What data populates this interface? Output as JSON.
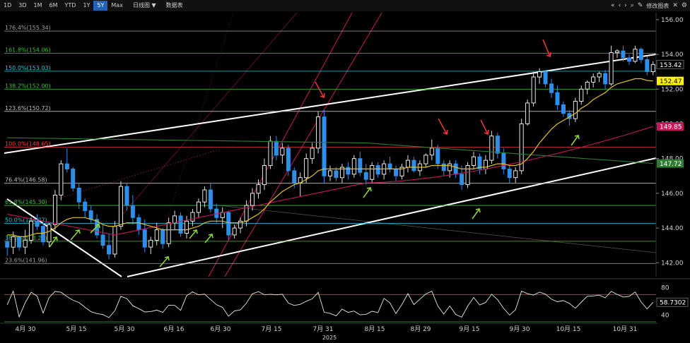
{
  "toolbar": {
    "ranges": [
      {
        "label": "1D",
        "active": false
      },
      {
        "label": "3D",
        "active": false
      },
      {
        "label": "1M",
        "active": false
      },
      {
        "label": "6M",
        "active": false
      },
      {
        "label": "YTD",
        "active": false
      },
      {
        "label": "1Y",
        "active": false
      },
      {
        "label": "5Y",
        "active": true
      },
      {
        "label": "Max",
        "active": false
      }
    ],
    "interval_label": "日线图 ▼",
    "table_label": "数据表",
    "edit_label": "修改图表",
    "icons": [
      "chevrons-left-icon",
      "chevron-left-icon",
      "chevron-right-icon",
      "search-icon",
      "edit-chart-icon",
      "close-icon",
      "gear-icon"
    ]
  },
  "price_axis": {
    "ticks": [
      "156.00",
      "154.00",
      "152.00",
      "150.00",
      "148.00",
      "146.00",
      "144.00",
      "142.00"
    ]
  },
  "price_badges": [
    {
      "label": "153.42",
      "value": 153.42,
      "bg": "#000000",
      "fg": "#ffffff"
    },
    {
      "label": "152.47",
      "value": 152.47,
      "bg": "#fff200",
      "fg": "#000000"
    },
    {
      "label": "149.85",
      "value": 149.85,
      "bg": "#c2185b",
      "fg": "#ffffff"
    },
    {
      "label": "147.72",
      "value": 147.72,
      "bg": "#2e7d32",
      "fg": "#ffffff"
    }
  ],
  "fib_levels": [
    {
      "label": "176.4%(155.34)",
      "value": 155.34,
      "color": "#9e9e9e"
    },
    {
      "label": "161.8%(154.06)",
      "value": 154.06,
      "color": "#39c03a"
    },
    {
      "label": "150.0%(153.03)",
      "value": 153.03,
      "color": "#26c6da"
    },
    {
      "label": "138.2%(152.00)",
      "value": 152.0,
      "color": "#39c03a"
    },
    {
      "label": "123.6%(150.72)",
      "value": 150.72,
      "color": "#bdbdbd"
    },
    {
      "label": "100.0%(148.65)",
      "value": 148.65,
      "color": "#ff3b3b"
    },
    {
      "label": "76.4%(146.58)",
      "value": 146.58,
      "color": "#bdbdbd"
    },
    {
      "label": "61.8%(145.30)",
      "value": 145.3,
      "color": "#39c03a"
    },
    {
      "label": "50.0%(144.27)",
      "value": 144.27,
      "color": "#26c6da"
    },
    {
      "label": "38.2%(143.24)",
      "value": 143.24,
      "color": "#39c03a"
    },
    {
      "label": "23.6%(141.96)",
      "value": 141.96,
      "color": "#9e9e9e"
    }
  ],
  "date_axis": {
    "labels": [
      "4月 30",
      "5月 15",
      "5月 30",
      "6月 16",
      "6月 30",
      "7月 15",
      "7月 31",
      "8月 15",
      "8月 29",
      "9月 15",
      "9月 30",
      "10月 15",
      "10月 31"
    ],
    "year": "2025"
  },
  "osc_axis": {
    "ticks": [
      "80",
      "60",
      "40"
    ]
  },
  "osc_badge": {
    "label": "58.7302",
    "value": 58.73
  },
  "chart_data": {
    "type": "candlestick",
    "ylim": [
      141.2,
      156.4
    ],
    "candles": [
      [
        143.2,
        143.6,
        142.4,
        142.9
      ],
      [
        142.9,
        143.8,
        142.5,
        143.5
      ],
      [
        143.5,
        143.4,
        142.7,
        142.9
      ],
      [
        142.9,
        143.9,
        142.5,
        143.3
      ],
      [
        143.3,
        144.6,
        143.1,
        144.4
      ],
      [
        144.4,
        144.8,
        143.9,
        144.1
      ],
      [
        144.1,
        144.3,
        143.0,
        143.2
      ],
      [
        143.2,
        144.3,
        142.9,
        144.2
      ],
      [
        144.2,
        146.2,
        143.9,
        145.9
      ],
      [
        145.9,
        147.9,
        145.6,
        147.7
      ],
      [
        147.7,
        148.6,
        147.2,
        147.4
      ],
      [
        147.4,
        147.5,
        146.1,
        146.3
      ],
      [
        146.3,
        146.6,
        145.1,
        145.5
      ],
      [
        145.5,
        145.7,
        144.6,
        145.0
      ],
      [
        145.0,
        145.3,
        144.3,
        144.5
      ],
      [
        144.5,
        144.8,
        143.4,
        143.6
      ],
      [
        143.6,
        144.2,
        142.8,
        143.0
      ],
      [
        143.0,
        143.7,
        142.2,
        142.5
      ],
      [
        142.5,
        144.4,
        142.3,
        144.1
      ],
      [
        144.1,
        146.7,
        143.9,
        146.4
      ],
      [
        146.4,
        146.6,
        145.0,
        145.3
      ],
      [
        145.3,
        145.9,
        144.2,
        144.6
      ],
      [
        144.6,
        144.8,
        143.6,
        143.9
      ],
      [
        143.9,
        144.5,
        142.6,
        142.9
      ],
      [
        142.9,
        143.5,
        142.5,
        143.3
      ],
      [
        143.3,
        144.3,
        143.0,
        143.9
      ],
      [
        143.9,
        144.0,
        142.8,
        143.1
      ],
      [
        143.1,
        144.6,
        142.9,
        144.3
      ],
      [
        144.3,
        145.0,
        143.9,
        144.7
      ],
      [
        144.7,
        144.9,
        143.5,
        143.7
      ],
      [
        143.7,
        144.7,
        143.4,
        144.4
      ],
      [
        144.4,
        145.1,
        144.1,
        144.9
      ],
      [
        144.9,
        145.7,
        144.6,
        145.5
      ],
      [
        145.5,
        146.4,
        145.2,
        146.2
      ],
      [
        146.2,
        146.6,
        144.9,
        145.1
      ],
      [
        145.1,
        145.4,
        144.3,
        144.6
      ],
      [
        144.6,
        145.2,
        144.0,
        144.9
      ],
      [
        144.9,
        145.0,
        143.3,
        143.6
      ],
      [
        143.6,
        144.2,
        143.4,
        144.0
      ],
      [
        144.0,
        144.6,
        143.7,
        144.4
      ],
      [
        144.4,
        145.6,
        144.1,
        145.3
      ],
      [
        145.3,
        146.3,
        145.0,
        146.0
      ],
      [
        146.0,
        146.8,
        145.7,
        146.5
      ],
      [
        146.5,
        148.0,
        146.2,
        147.6
      ],
      [
        147.6,
        149.3,
        147.4,
        149.0
      ],
      [
        149.0,
        149.3,
        147.9,
        148.2
      ],
      [
        148.2,
        148.9,
        147.7,
        148.6
      ],
      [
        148.6,
        148.8,
        147.0,
        147.3
      ],
      [
        147.3,
        147.5,
        146.3,
        146.6
      ],
      [
        146.6,
        147.2,
        145.8,
        146.9
      ],
      [
        146.9,
        148.3,
        146.6,
        148.0
      ],
      [
        148.0,
        148.9,
        147.7,
        148.6
      ],
      [
        148.6,
        150.7,
        148.3,
        150.4
      ],
      [
        150.4,
        150.8,
        146.6,
        147.0
      ],
      [
        147.0,
        147.6,
        146.7,
        147.3
      ],
      [
        147.3,
        147.5,
        146.7,
        146.9
      ],
      [
        146.9,
        147.7,
        146.6,
        147.5
      ],
      [
        147.5,
        147.8,
        146.8,
        147.1
      ],
      [
        147.1,
        148.2,
        146.9,
        148.0
      ],
      [
        148.0,
        148.4,
        147.0,
        147.2
      ],
      [
        147.2,
        147.7,
        146.5,
        146.8
      ],
      [
        146.8,
        147.8,
        146.6,
        147.6
      ],
      [
        147.6,
        147.8,
        146.9,
        147.1
      ],
      [
        147.1,
        147.9,
        146.8,
        147.7
      ],
      [
        147.7,
        148.1,
        147.2,
        147.4
      ],
      [
        147.4,
        147.6,
        146.7,
        147.0
      ],
      [
        147.0,
        147.7,
        146.8,
        147.5
      ],
      [
        147.5,
        148.2,
        147.2,
        147.9
      ],
      [
        147.9,
        148.1,
        147.2,
        147.3
      ],
      [
        147.3,
        147.9,
        147.0,
        147.7
      ],
      [
        147.7,
        148.3,
        147.5,
        148.2
      ],
      [
        148.2,
        149.1,
        147.9,
        148.6
      ],
      [
        148.6,
        148.8,
        147.4,
        147.7
      ],
      [
        147.7,
        147.9,
        147.0,
        147.3
      ],
      [
        147.3,
        147.9,
        146.9,
        147.7
      ],
      [
        147.7,
        147.9,
        146.9,
        147.1
      ],
      [
        147.1,
        147.6,
        146.2,
        146.5
      ],
      [
        146.5,
        147.8,
        146.3,
        147.6
      ],
      [
        147.6,
        148.4,
        147.4,
        148.1
      ],
      [
        148.1,
        148.3,
        147.1,
        147.4
      ],
      [
        147.4,
        148.2,
        147.1,
        147.9
      ],
      [
        147.9,
        149.6,
        147.7,
        149.3
      ],
      [
        149.3,
        149.5,
        148.0,
        148.3
      ],
      [
        148.3,
        148.6,
        147.1,
        147.4
      ],
      [
        147.4,
        147.6,
        146.6,
        146.9
      ],
      [
        146.9,
        147.5,
        146.6,
        147.3
      ],
      [
        147.3,
        150.3,
        147.1,
        150.0
      ],
      [
        150.0,
        151.4,
        149.9,
        151.2
      ],
      [
        151.2,
        153.0,
        151.0,
        152.7
      ],
      [
        152.7,
        153.2,
        152.3,
        153.0
      ],
      [
        153.0,
        153.1,
        152.1,
        152.3
      ],
      [
        152.3,
        152.6,
        151.5,
        151.8
      ],
      [
        151.8,
        152.2,
        150.8,
        151.1
      ],
      [
        151.1,
        151.3,
        150.4,
        150.6
      ],
      [
        150.6,
        150.8,
        149.9,
        150.3
      ],
      [
        150.3,
        151.5,
        150.1,
        151.3
      ],
      [
        151.3,
        152.2,
        151.1,
        152.0
      ],
      [
        152.0,
        152.5,
        151.7,
        152.4
      ],
      [
        152.4,
        152.9,
        152.1,
        152.7
      ],
      [
        152.7,
        153.0,
        152.4,
        152.9
      ],
      [
        152.9,
        153.1,
        152.0,
        152.3
      ],
      [
        152.3,
        154.5,
        152.2,
        154.1
      ],
      [
        154.1,
        154.3,
        153.8,
        154.2
      ],
      [
        154.2,
        154.5,
        153.6,
        153.8
      ],
      [
        153.8,
        154.0,
        153.4,
        153.6
      ],
      [
        153.6,
        154.5,
        153.5,
        154.3
      ],
      [
        154.3,
        154.4,
        153.5,
        153.7
      ],
      [
        153.7,
        153.9,
        152.8,
        153.0
      ],
      [
        153.0,
        153.6,
        152.8,
        153.42
      ]
    ],
    "ma_yellow": [
      143.6,
      143.6,
      143.5,
      143.5,
      143.6,
      143.7,
      143.7,
      143.8,
      144.0,
      144.3,
      144.5,
      144.6,
      144.6,
      144.6,
      144.5,
      144.4,
      144.2,
      144.1,
      144.1,
      144.2,
      144.3,
      144.3,
      144.3,
      144.2,
      144.1,
      144.0,
      143.9,
      143.9,
      143.9,
      143.9,
      143.9,
      144.0,
      144.1,
      144.3,
      144.4,
      144.4,
      144.4,
      144.3,
      144.3,
      144.3,
      144.4,
      144.6,
      144.8,
      145.1,
      145.5,
      145.8,
      146.1,
      146.3,
      146.5,
      146.6,
      146.8,
      147.0,
      147.3,
      147.4,
      147.4,
      147.4,
      147.4,
      147.4,
      147.4,
      147.4,
      147.4,
      147.4,
      147.4,
      147.4,
      147.4,
      147.4,
      147.4,
      147.5,
      147.5,
      147.5,
      147.5,
      147.6,
      147.6,
      147.6,
      147.6,
      147.5,
      147.4,
      147.4,
      147.4,
      147.5,
      147.5,
      147.6,
      147.7,
      147.7,
      147.6,
      147.6,
      147.7,
      148.0,
      148.4,
      148.9,
      149.3,
      149.7,
      150.0,
      150.2,
      150.4,
      150.6,
      150.9,
      151.1,
      151.4,
      151.6,
      151.8,
      152.1,
      152.3,
      152.4,
      152.5,
      152.6,
      152.6,
      152.5,
      152.47
    ],
    "ma_magenta": {
      "start": 144.8,
      "dip": 143.6,
      "dip_index": 18,
      "mid": 146.6,
      "mid_index": 60,
      "end": 149.85
    },
    "ma_green": {
      "start": 149.2,
      "peak": 148.9,
      "peak_index": 60,
      "end": 147.72
    },
    "oscillator": {
      "ylim": [
        30,
        90
      ],
      "upper_band": 70,
      "lower_band": 30,
      "last": 58.73
    }
  }
}
